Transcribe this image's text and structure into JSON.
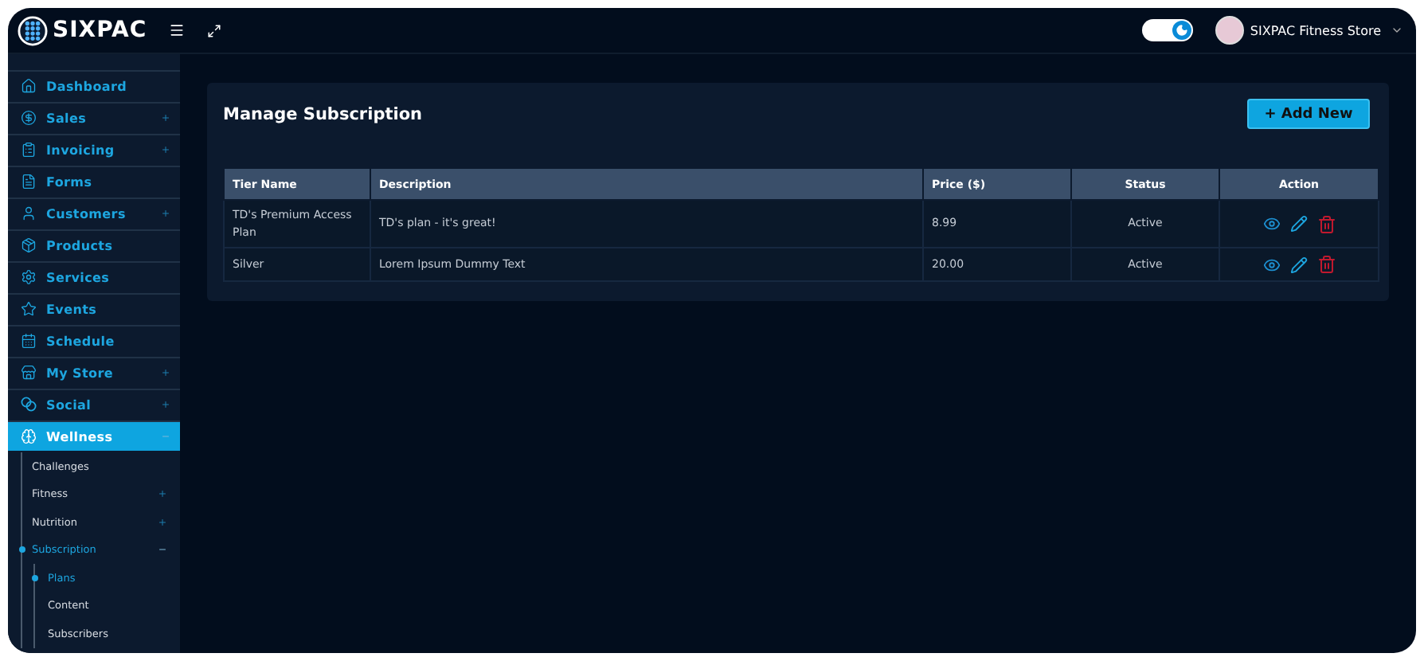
{
  "topbar": {
    "logo": "SIXPAC",
    "dark_mode": {
      "on": true
    },
    "account": "SIXPAC Fitness Store"
  },
  "sidebar": {
    "items": [
      {
        "label": "Dashboard",
        "selected": false
      },
      {
        "label": "Sales",
        "selected": false,
        "expanded": false
      },
      {
        "label": "Invoicing",
        "selected": false,
        "expanded": false
      },
      {
        "label": "Forms",
        "selected": false
      },
      {
        "label": "Customers",
        "selected": false,
        "expanded": false
      },
      {
        "label": "Products",
        "selected": false
      },
      {
        "label": "Services",
        "selected": false
      },
      {
        "label": "Events",
        "selected": false
      },
      {
        "label": "Schedule",
        "selected": false
      },
      {
        "label": "My Store",
        "selected": false,
        "expanded": false
      },
      {
        "label": "Social",
        "selected": false,
        "expanded": false
      },
      {
        "label": "Wellness",
        "selected": true,
        "expanded": true,
        "children": [
          {
            "label": "Challenges",
            "selected": false
          },
          {
            "label": "Fitness",
            "selected": false,
            "expanded": false
          },
          {
            "label": "Nutrition",
            "selected": false,
            "expanded": false
          },
          {
            "label": "Subscription",
            "selected": true,
            "expanded": true,
            "children": [
              {
                "label": "Plans",
                "selected": true
              },
              {
                "label": "Content",
                "selected": false
              },
              {
                "label": "Subscribers",
                "selected": false
              }
            ]
          }
        ]
      }
    ]
  },
  "card": {
    "title": "Manage Subscription",
    "add_button": "+ Add New",
    "table": {
      "columns": [
        "Tier Name",
        "Description",
        "Price ($)",
        "Status",
        "Action"
      ],
      "rows": [
        {
          "tier": "TD's Premium Access Plan",
          "description": "TD's plan - it's great!",
          "price": "8.99",
          "status": "Active"
        },
        {
          "tier": "Silver",
          "description": "Lorem Ipsum Dummy Text",
          "price": "20.00",
          "status": "Active"
        }
      ]
    }
  }
}
